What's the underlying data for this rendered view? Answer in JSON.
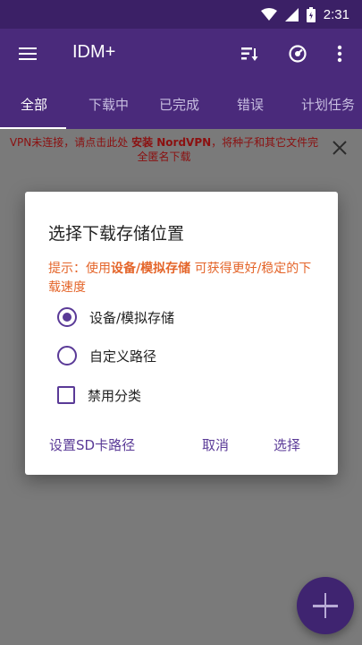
{
  "status_bar": {
    "time": "2:31",
    "icons": [
      "wifi-icon",
      "cellular-signal-icon",
      "battery-icon"
    ]
  },
  "app_bar": {
    "title": "IDM+",
    "icons": [
      "menu-icon",
      "sort-icon",
      "speed-icon",
      "more-vert-icon"
    ]
  },
  "tabs": [
    {
      "label": "全部",
      "active": true
    },
    {
      "label": "下载中",
      "active": false
    },
    {
      "label": "已完成",
      "active": false
    },
    {
      "label": "错误",
      "active": false
    },
    {
      "label": "计划任务",
      "active": false
    }
  ],
  "vpn_banner": {
    "text_before": "VPN未连接，请点击此处 ",
    "link": "安装 NordVPN",
    "text_after": "，将种子和其它文件完全匿名下载"
  },
  "dialog": {
    "title": "选择下载存储位置",
    "hint_prefix": "提示：使用",
    "hint_emphasis": "设备/模拟存储",
    "hint_suffix": "可获得更好/稳定的下载速度",
    "options": [
      {
        "label": "设备/模拟存储",
        "type": "radio",
        "checked": true
      },
      {
        "label": "自定义路径",
        "type": "radio",
        "checked": false
      },
      {
        "label": "禁用分类",
        "type": "checkbox",
        "checked": false
      }
    ],
    "buttons": {
      "sd_card": "设置SD卡路径",
      "cancel": "取消",
      "select": "选择"
    }
  },
  "fab": {
    "icon": "add-icon"
  },
  "colors": {
    "primary": "#4a2a7b",
    "status_bar": "#3b2066",
    "accent": "#5a3a97",
    "hint": "#e4652a",
    "banner_text": "#8b1010"
  }
}
